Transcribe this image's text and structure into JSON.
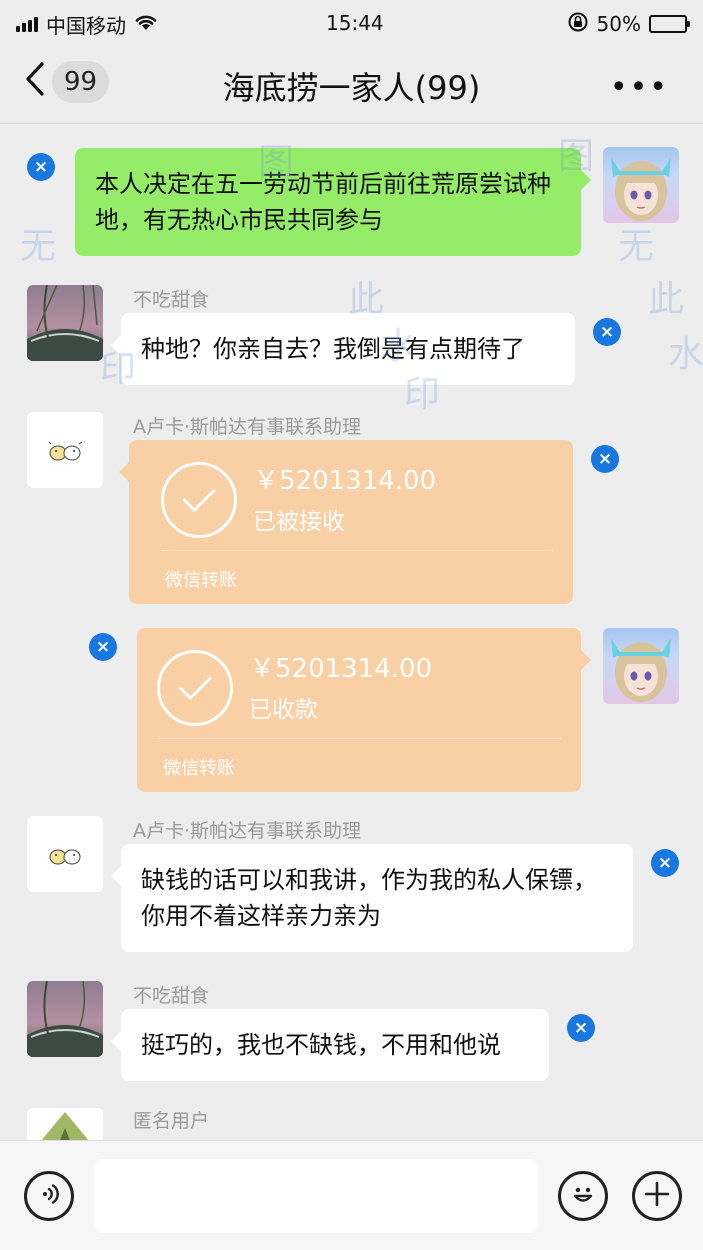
{
  "status": {
    "carrier": "中国移动",
    "time": "15:44",
    "battery": "50%",
    "battery_level": 0.5
  },
  "nav": {
    "back_count": "99",
    "title": "海底捞一家人(99)",
    "more": "•••"
  },
  "messages": [
    {
      "text": "本人决定在五一劳动节前后前往荒原尝试种地，有无热心市民共同参与"
    },
    {
      "sender": "不吃甜食",
      "text": "种地？你亲自去？我倒是有点期待了"
    },
    {
      "sender": "A卢卡·斯帕达有事联系助理",
      "amount": "￥5201314.00",
      "status": "已被接收",
      "footer": "微信转账"
    },
    {
      "amount": "￥5201314.00",
      "status": "已收款",
      "footer": "微信转账"
    },
    {
      "sender": "A卢卡·斯帕达有事联系助理",
      "text": "缺钱的话可以和我讲，作为我的私人保镖，你用不着这样亲力亲为"
    },
    {
      "sender": "不吃甜食",
      "text": "挺巧的，我也不缺钱，不用和他说"
    },
    {
      "sender": "匿名用户"
    }
  ],
  "remove_icon": "×",
  "input": {
    "placeholder": ""
  },
  "watermark": [
    "成",
    "的",
    "图",
    "无",
    "此",
    "印",
    "水",
    "无",
    "此",
    "印",
    "成",
    "的",
    "图",
    "水"
  ]
}
